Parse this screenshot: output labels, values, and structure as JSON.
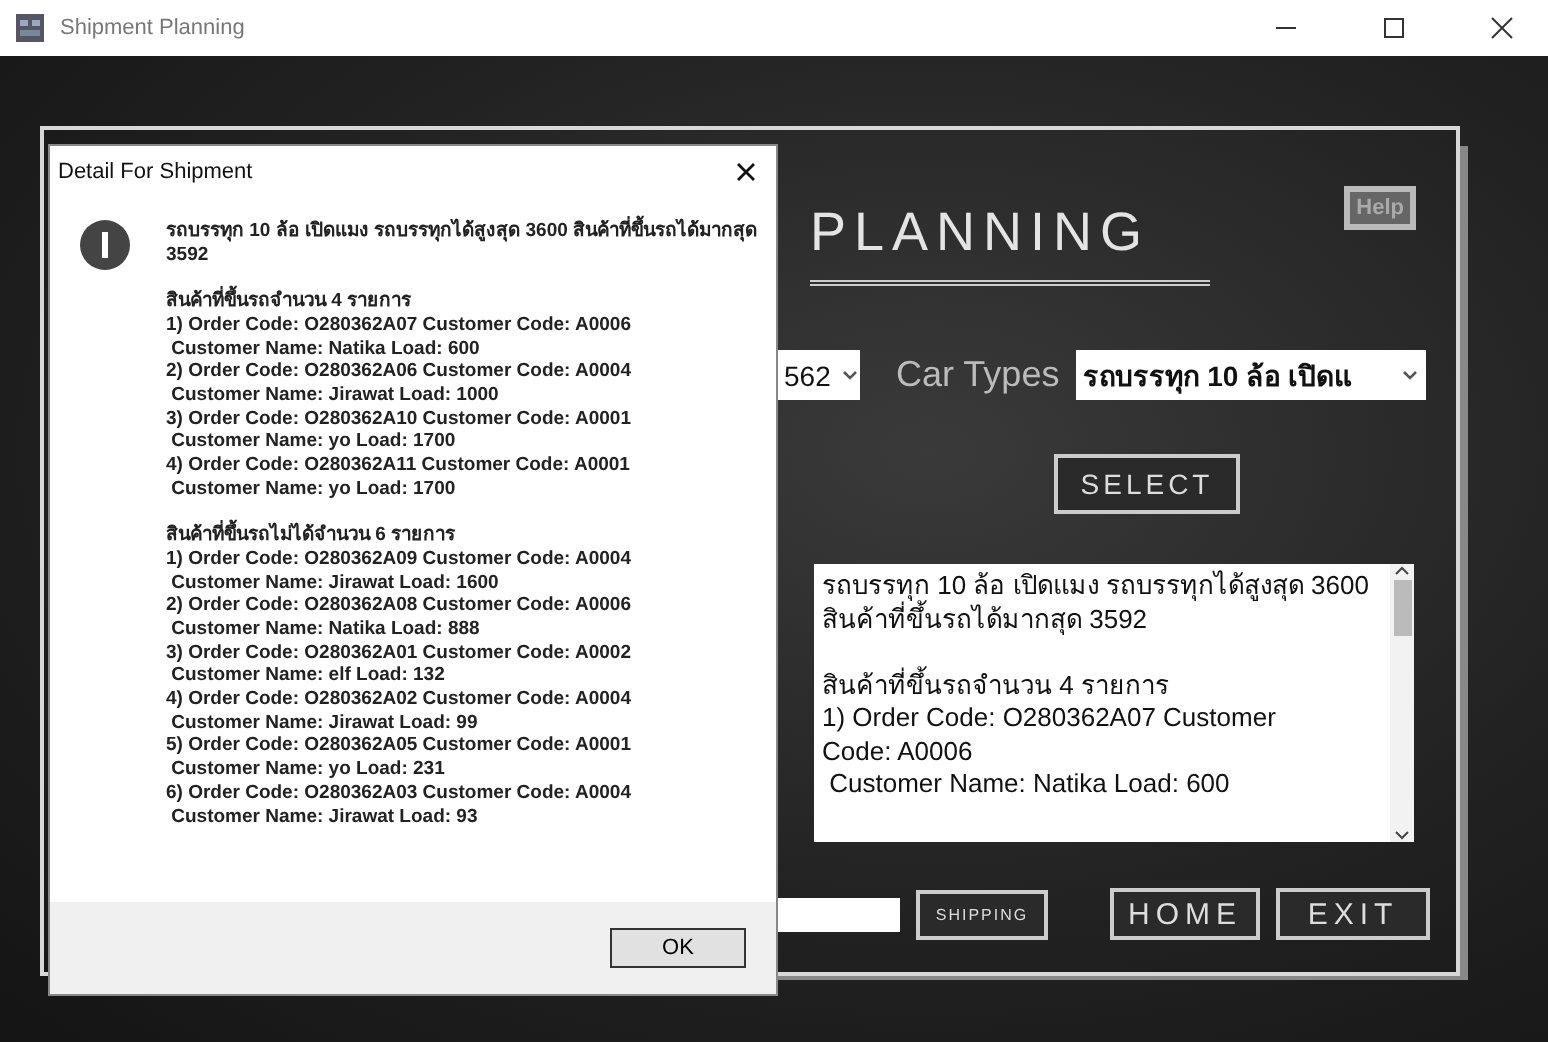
{
  "window": {
    "title": "Shipment Planning"
  },
  "app": {
    "heading": "PLANNING",
    "help_button": "Help",
    "order_combo": {
      "value": "562"
    },
    "car_types_label": "Car Types",
    "car_type_combo": {
      "value": "รถบรรทุก 10 ล้อ เปิดแ"
    },
    "select_button": "SELECT",
    "details": [
      [
        "รถบรรทุก 10 ล้อ เปิดแมง รถบรรทุกได้สูงสุด 3600",
        "สินค้าที่ขึ้นรถได้มากสุด 3592"
      ],
      [
        "สินค้าที่ขึ้นรถจำนวน 4 รายการ",
        "1) Order Code: O280362A07 Customer",
        "Code: A0006",
        " Customer Name: Natika Load: 600"
      ]
    ],
    "shipping_button": "SHIPPING",
    "home_button": "HOME",
    "exit_button": "EXIT"
  },
  "dialog": {
    "title": "Detail For Shipment",
    "blocks": [
      [
        "รถบรรทุก 10 ล้อ เปิดแมง รถบรรทุกได้สูงสุด 3600 สินค้าที่ขึ้นรถได้มากสุด",
        "3592"
      ],
      [
        "สินค้าที่ขึ้นรถจำนวน 4 รายการ",
        "1) Order Code: O280362A07 Customer Code: A0006",
        " Customer Name: Natika Load: 600",
        "2) Order Code: O280362A06 Customer Code: A0004",
        " Customer Name: Jirawat Load: 1000",
        "3) Order Code: O280362A10 Customer Code: A0001",
        " Customer Name: yo Load: 1700",
        "4) Order Code: O280362A11 Customer Code: A0001",
        " Customer Name: yo Load: 1700"
      ],
      [
        "สินค้าที่ขึ้นรถไม่ได้จำนวน 6 รายการ",
        "1) Order Code: O280362A09 Customer Code: A0004",
        " Customer Name: Jirawat Load: 1600",
        "2) Order Code: O280362A08 Customer Code: A0006",
        " Customer Name: Natika Load: 888",
        "3) Order Code: O280362A01 Customer Code: A0002",
        " Customer Name: elf Load: 132",
        "4) Order Code: O280362A02 Customer Code: A0004",
        " Customer Name: Jirawat Load: 99",
        "5) Order Code: O280362A05 Customer Code: A0001",
        " Customer Name: yo Load: 231",
        "6) Order Code: O280362A03 Customer Code: A0004",
        " Customer Name: Jirawat Load: 93"
      ]
    ],
    "ok_button": "OK"
  }
}
